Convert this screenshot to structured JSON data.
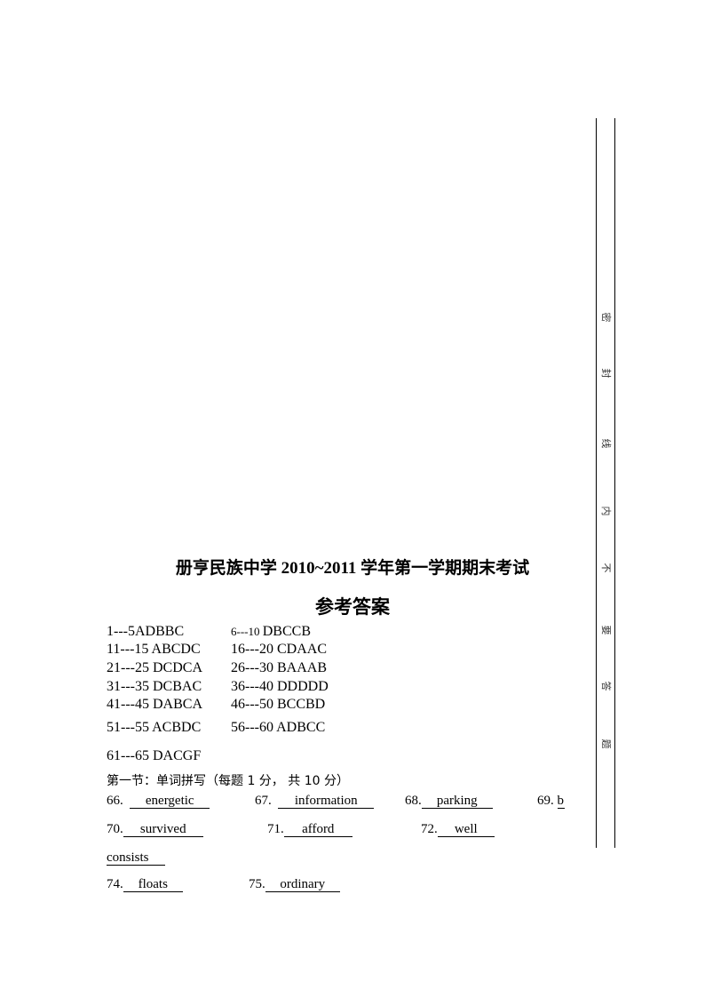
{
  "margin_seal": {
    "chars": [
      "密",
      "封",
      "线",
      "内",
      "不",
      "要",
      "答",
      "题"
    ]
  },
  "title": "册亨民族中学 2010~2011 学年第一学期期末考试",
  "subtitle": "参考答案",
  "choice_answers": [
    {
      "left_range": "1---5",
      "left_answer": "ADBBC",
      "right_range": "6---10",
      "right_answer": "DBCCB"
    },
    {
      "left_range": "11---15",
      "left_answer": "ABCDC",
      "right_range": "16---20",
      "right_answer": "CDAAC"
    },
    {
      "left_range": "21---25",
      "left_answer": "DCDCA",
      "right_range": "26---30",
      "right_answer": "BAAAB"
    },
    {
      "left_range": "31---35",
      "left_answer": "DCBAC",
      "right_range": "36---40",
      "right_answer": "DDDDD"
    },
    {
      "left_range": "41---45",
      "left_answer": "DABCA",
      "right_range": "46---50",
      "right_answer": "BCCBD"
    },
    {
      "left_range": "51---55",
      "left_answer": "ACBDC",
      "right_range": "56---60",
      "right_answer": "ADBCC"
    },
    {
      "left_range": "61---65",
      "left_answer": "DACGF"
    }
  ],
  "section_heading": "第一节：单词拼写（每题  1  分，  共 10  分）",
  "spelling": [
    {
      "num": "66.",
      "answer": "energetic"
    },
    {
      "num": "67.",
      "answer": "information"
    },
    {
      "num": "68.",
      "answer": "parking"
    },
    {
      "num": "69.",
      "answer": "b"
    },
    {
      "num": "70.",
      "answer": "survived"
    },
    {
      "num": "71.",
      "answer": "afford"
    },
    {
      "num": "72.",
      "answer": "well"
    },
    {
      "num": "",
      "answer": "consists"
    },
    {
      "num": "74.",
      "answer": "floats"
    },
    {
      "num": "75.",
      "answer": "ordinary"
    }
  ]
}
